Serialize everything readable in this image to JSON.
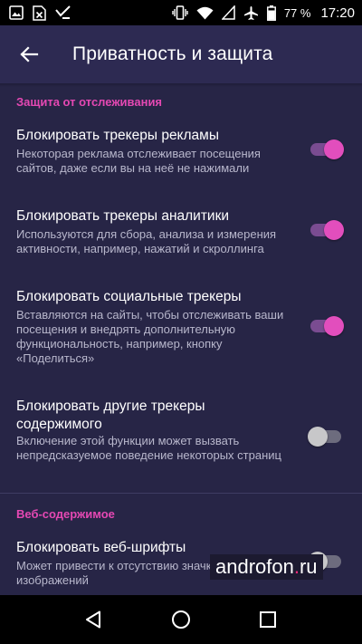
{
  "status_bar": {
    "battery_percent": "77 %",
    "time": "17:20",
    "icons": [
      "image-icon",
      "excel-icon",
      "checkmark-download-icon",
      "vibrate-icon",
      "wifi-icon",
      "no-sim-icon",
      "airplane-icon",
      "battery-icon"
    ]
  },
  "app_bar": {
    "title": "Приватность и защита",
    "back_icon": "arrow-back-icon"
  },
  "sections": [
    {
      "header": "Защита от отслеживания",
      "items": [
        {
          "title": "Блокировать трекеры рекламы",
          "summary": "Некоторая реклама отслеживает посещения сайтов, даже если вы на неё не нажимали",
          "enabled": true
        },
        {
          "title": "Блокировать трекеры аналитики",
          "summary": "Используются для сбора, анализа и измерения активности, например, нажатий и скроллинга",
          "enabled": true
        },
        {
          "title": "Блокировать социальные трекеры",
          "summary": "Вставляются на сайты, чтобы отслеживать ваши посещения и внедрять дополнительную функциональность, например, кнопку «Поделиться»",
          "enabled": true
        },
        {
          "title": "Блокировать другие трекеры содержимого",
          "summary": "Включение этой функции может вызвать непредсказуемое поведение некоторых страниц",
          "enabled": false
        }
      ]
    },
    {
      "header": "Веб-содержимое",
      "items": [
        {
          "title": "Блокировать веб-шрифты",
          "summary": "Может привести к отсутствию значков или изображений",
          "enabled": false
        }
      ]
    }
  ],
  "watermark": {
    "name": "androfon",
    "dot": ".",
    "tld": "ru"
  },
  "colors": {
    "background": "#272546",
    "app_bar": "#2d2a52",
    "accent": "#e548b3",
    "toggle_on_thumb": "#e24ebd",
    "toggle_on_track": "#7a4c91"
  },
  "nav_bar": {
    "icons": [
      "back-triangle-icon",
      "home-circle-icon",
      "recents-square-icon"
    ]
  }
}
